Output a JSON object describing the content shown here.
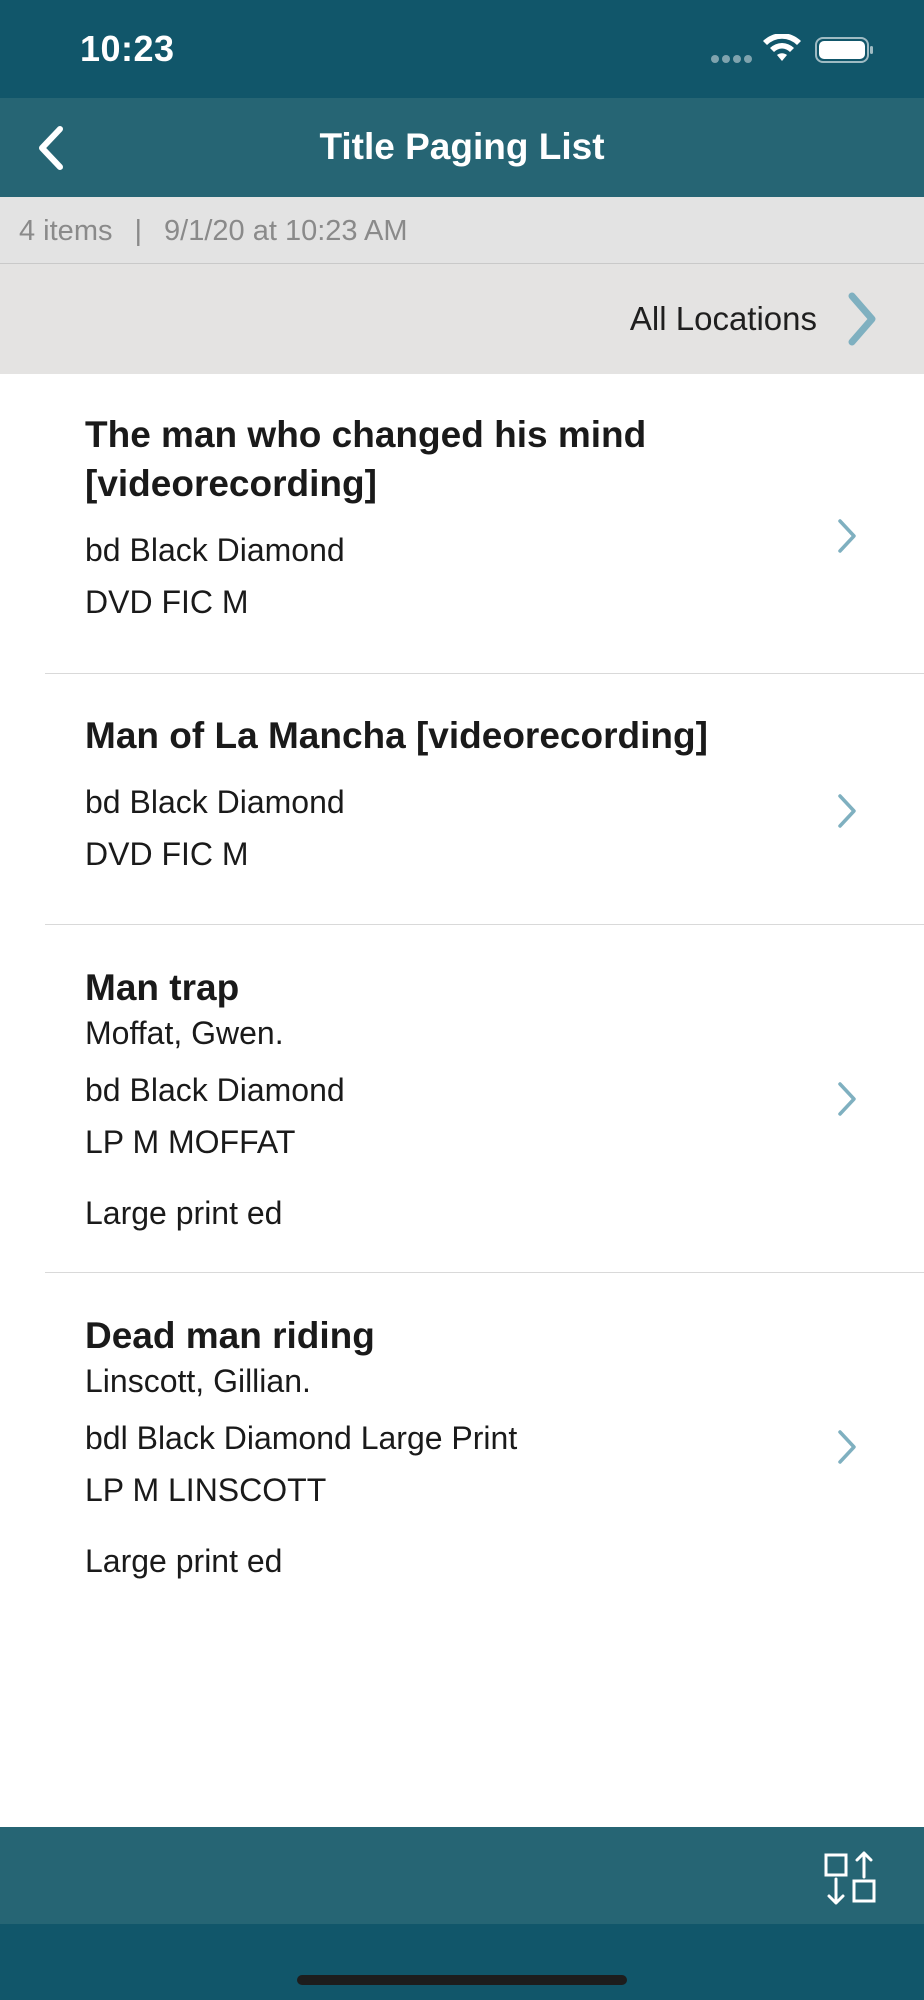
{
  "status_bar": {
    "time": "10:23"
  },
  "nav": {
    "title": "Title Paging List",
    "back_icon": "chevron-left-icon"
  },
  "info": {
    "count": "4 items",
    "separator": "|",
    "timestamp": "9/1/20 at 10:23 AM"
  },
  "location": {
    "label": "All Locations",
    "icon": "chevron-right-icon"
  },
  "items": [
    {
      "title_line1": "The man who changed his mind",
      "title_line2": "[videorecording]",
      "location": "bd Black Diamond",
      "call_number": "DVD FIC M"
    },
    {
      "title": "Man of La Mancha [videorecording]",
      "location": "bd Black Diamond",
      "call_number": "DVD FIC M"
    },
    {
      "title": "Man trap",
      "author": "Moffat, Gwen.",
      "location": "bd Black Diamond",
      "call_number": "LP M MOFFAT",
      "note": "Large print ed"
    },
    {
      "title": "Dead man riding",
      "author": "Linscott, Gillian.",
      "location": "bdl Black Diamond Large Print",
      "call_number": "LP M LINSCOTT",
      "note": "Large print ed"
    }
  ],
  "toolbar": {
    "sort_icon": "sort-icon"
  },
  "colors": {
    "status_bar": "#11566a",
    "nav_bar": "#266574",
    "info_bar": "#e3e3e3",
    "chevron": "#7fb0c0"
  }
}
